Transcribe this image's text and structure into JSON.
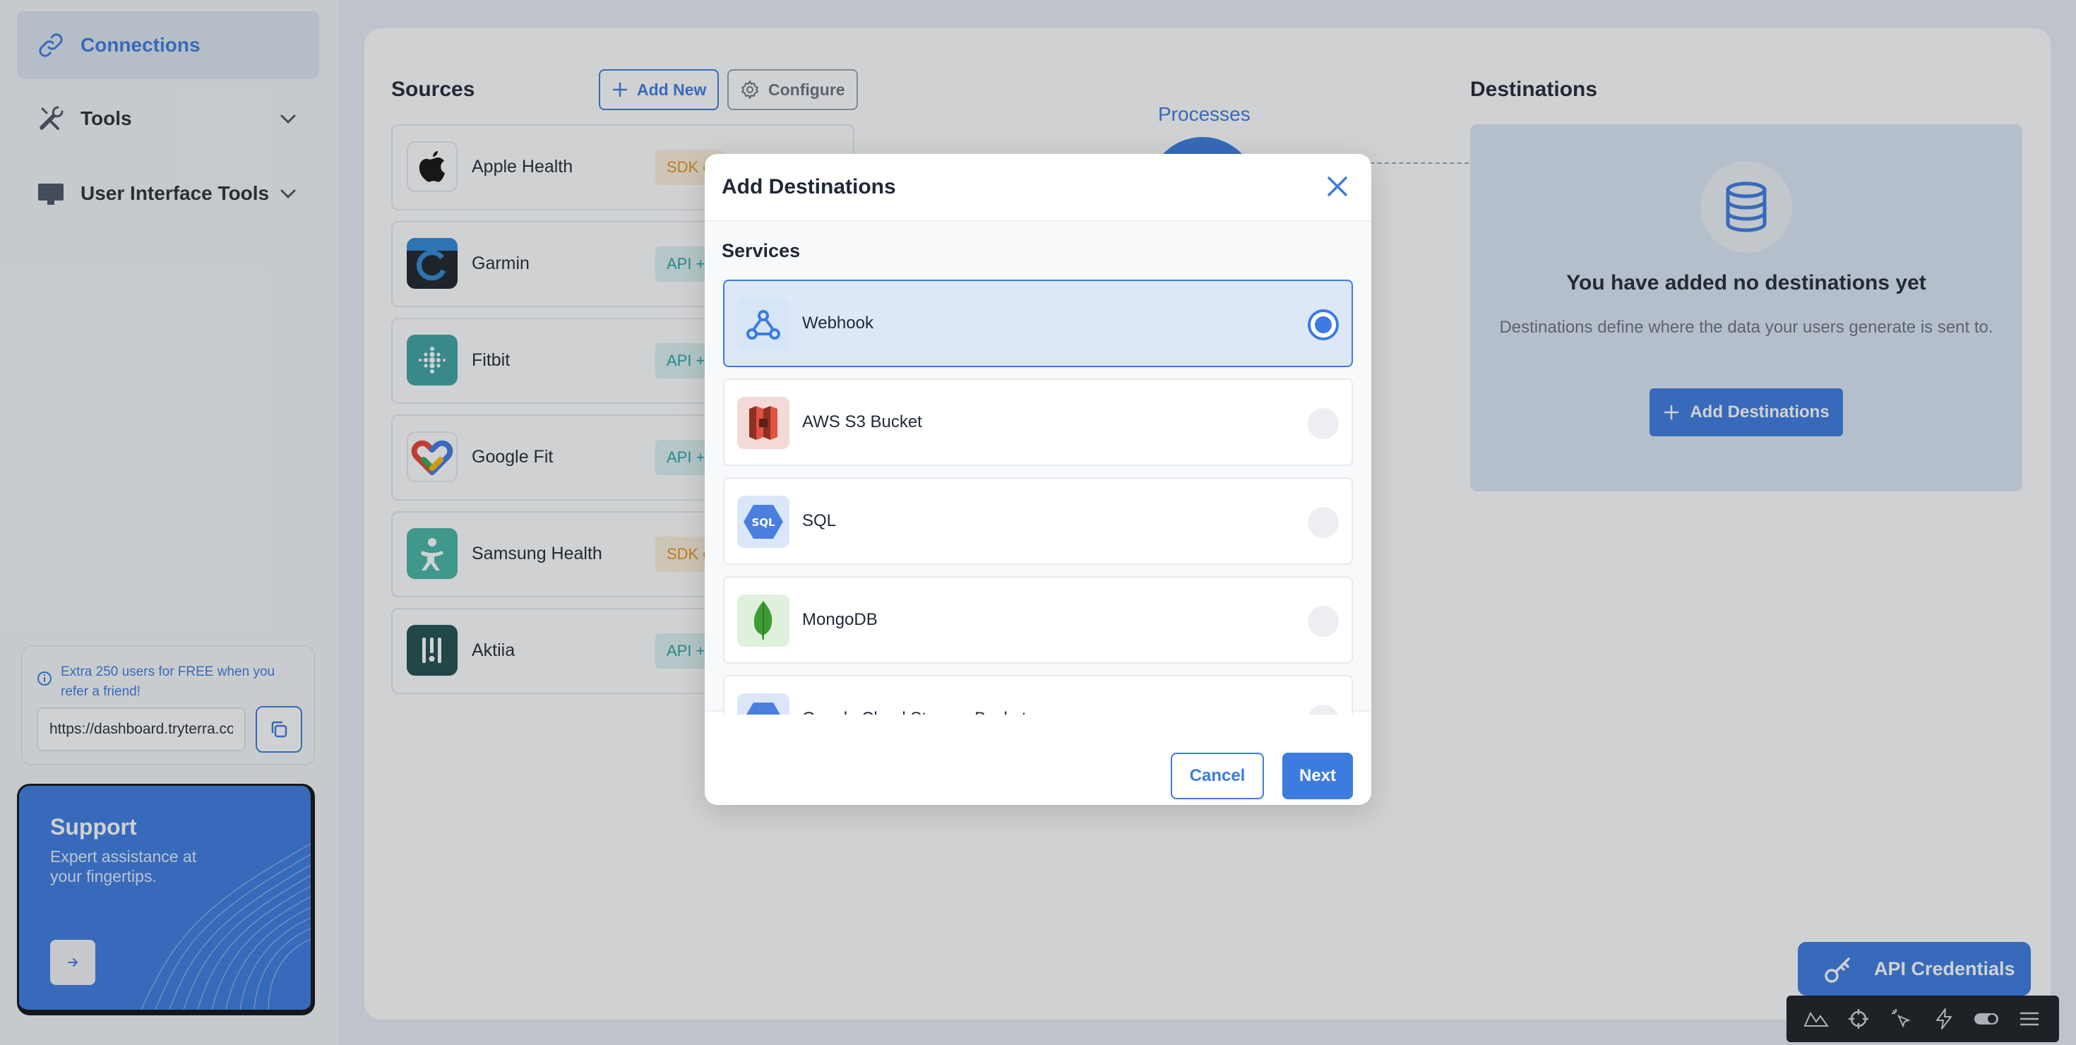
{
  "sidebar": {
    "items": [
      {
        "label": "Connections",
        "icon": "link-icon"
      },
      {
        "label": "Tools",
        "icon": "tools-icon"
      },
      {
        "label": "User Interface Tools",
        "icon": "monitor-icon"
      }
    ],
    "referral": {
      "text": "Extra 250 users for FREE when you refer a friend!",
      "link_value": "https://dashboard.tryterra.co/referral"
    },
    "support": {
      "title": "Support",
      "subtitle": "Expert assistance at your fingertips."
    }
  },
  "sources": {
    "title": "Sources",
    "add_new_label": "Add New",
    "configure_label": "Configure",
    "items": [
      {
        "name": "Apple Health",
        "tag": "SDK o"
      },
      {
        "name": "Garmin",
        "tag": "API +"
      },
      {
        "name": "Fitbit",
        "tag": "API +"
      },
      {
        "name": "Google Fit",
        "tag": "API +"
      },
      {
        "name": "Samsung Health",
        "tag": "SDK o"
      },
      {
        "name": "Aktiia",
        "tag": "API +"
      }
    ]
  },
  "processes": {
    "title": "Processes"
  },
  "destinations": {
    "title": "Destinations",
    "empty_heading": "You have added no destinations yet",
    "empty_description": "Destinations define where the data your users generate is sent to.",
    "add_label": "Add Destinations"
  },
  "api_credentials_label": "API Credentials",
  "modal": {
    "title": "Add Destinations",
    "section_label": "Services",
    "services": [
      {
        "name": "Webhook",
        "selected": true
      },
      {
        "name": "AWS S3 Bucket",
        "selected": false
      },
      {
        "name": "SQL",
        "selected": false
      },
      {
        "name": "MongoDB",
        "selected": false
      },
      {
        "name": "Google Cloud Storage Bucket",
        "selected": false
      }
    ],
    "cancel_label": "Cancel",
    "next_label": "Next",
    "sql_logo_text": "SQL"
  },
  "colors": {
    "accent": "#3c7be0",
    "sdk_tag": "#e59419",
    "api_tag": "#27a3a3"
  }
}
